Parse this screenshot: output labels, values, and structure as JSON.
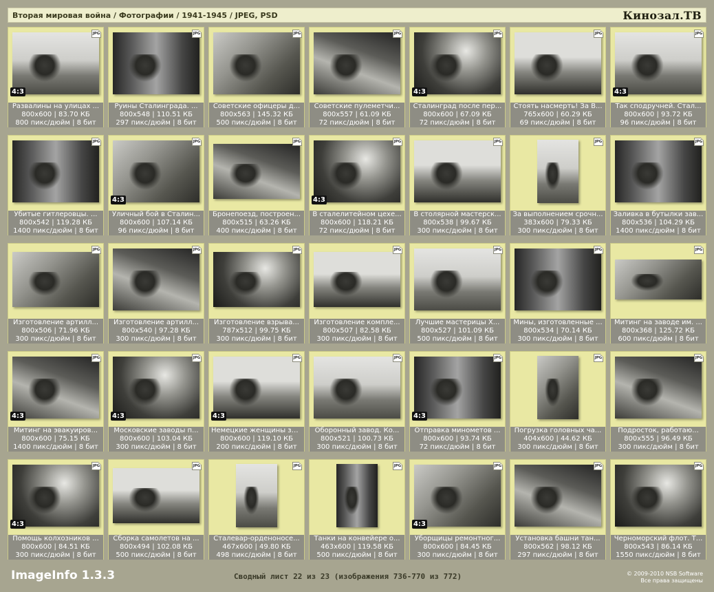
{
  "header": {
    "breadcrumb": "Вторая мировая война / Фотографии / 1941-1945 / JPEG, PSD",
    "site_logo": "Кинозал.ТВ"
  },
  "tiles": [
    {
      "name": "Развалины на улицах ...",
      "info": "800x600 | 83.70 КБ",
      "dpi": "800 пикс/дюйм | 8 бит",
      "ratio": "4:3",
      "orient": "l"
    },
    {
      "name": "Руины Сталинграда. ...",
      "info": "800x548 | 110.51 КБ",
      "dpi": "297 пикс/дюйм | 8 бит",
      "ratio": "",
      "orient": "l"
    },
    {
      "name": "Советские офицеры д...",
      "info": "800x563 | 145.32 КБ",
      "dpi": "500 пикс/дюйм | 8 бит",
      "ratio": "",
      "orient": "l"
    },
    {
      "name": "Советские пулеметчи...",
      "info": "800x557 | 61.09 КБ",
      "dpi": "72 пикс/дюйм | 8 бит",
      "ratio": "",
      "orient": "l"
    },
    {
      "name": "Сталинград после пер...",
      "info": "800x600 | 67.09 КБ",
      "dpi": "72 пикс/дюйм | 8 бит",
      "ratio": "4:3",
      "orient": "l"
    },
    {
      "name": "Стоять насмерть! За В...",
      "info": "765x600 | 60.29 КБ",
      "dpi": "69 пикс/дюйм | 8 бит",
      "ratio": "",
      "orient": "l"
    },
    {
      "name": "Так сподручней. Стал...",
      "info": "800x600 | 93.72 КБ",
      "dpi": "96 пикс/дюйм | 8 бит",
      "ratio": "4:3",
      "orient": "l"
    },
    {
      "name": "Убитые гитлеровцы. ...",
      "info": "800x542 | 119.28 КБ",
      "dpi": "1400 пикс/дюйм | 8 бит",
      "ratio": "",
      "orient": "l"
    },
    {
      "name": "Уличный бой в Сталин...",
      "info": "800x600 | 107.14 КБ",
      "dpi": "96 пикс/дюйм | 8 бит",
      "ratio": "4:3",
      "orient": "l"
    },
    {
      "name": "Бронепоезд, построен...",
      "info": "800x515 | 63.26 КБ",
      "dpi": "400 пикс/дюйм | 8 бит",
      "ratio": "",
      "orient": "w"
    },
    {
      "name": "В сталелитейном цехе...",
      "info": "800x600 | 118.21 КБ",
      "dpi": "72 пикс/дюйм | 8 бит",
      "ratio": "4:3",
      "orient": "l"
    },
    {
      "name": "В столярной мастерск...",
      "info": "800x538 | 99.67 КБ",
      "dpi": "300 пикс/дюйм | 8 бит",
      "ratio": "",
      "orient": "l"
    },
    {
      "name": "За выполнением срочн...",
      "info": "383x600 | 79.33 КБ",
      "dpi": "300 пикс/дюйм | 8 бит",
      "ratio": "",
      "orient": "p"
    },
    {
      "name": "Заливка в бутылки зав...",
      "info": "800x536 | 104.29 КБ",
      "dpi": "1400 пикс/дюйм | 8 бит",
      "ratio": "",
      "orient": "l"
    },
    {
      "name": "Изготовление артилл...",
      "info": "800x506 | 71.96 КБ",
      "dpi": "300 пикс/дюйм | 8 бит",
      "ratio": "",
      "orient": "w"
    },
    {
      "name": "Изготовление артилл...",
      "info": "800x540 | 97.28 КБ",
      "dpi": "300 пикс/дюйм | 8 бит",
      "ratio": "",
      "orient": "l"
    },
    {
      "name": "Изготовление взрыва...",
      "info": "787x512 | 99.75 КБ",
      "dpi": "300 пикс/дюйм | 8 бит",
      "ratio": "",
      "orient": "w"
    },
    {
      "name": "Изготовление компле...",
      "info": "800x507 | 82.58 КБ",
      "dpi": "300 пикс/дюйм | 8 бит",
      "ratio": "",
      "orient": "w"
    },
    {
      "name": "Лучшие мастерицы Х...",
      "info": "800x527 | 101.09 КБ",
      "dpi": "500 пикс/дюйм | 8 бит",
      "ratio": "",
      "orient": "l"
    },
    {
      "name": "Мины, изготовленные ...",
      "info": "800x534 | 70.14 КБ",
      "dpi": "300 пикс/дюйм | 8 бит",
      "ratio": "",
      "orient": "l"
    },
    {
      "name": "Митинг на заводе им. ...",
      "info": "800x368 | 125.72 КБ",
      "dpi": "600 пикс/дюйм | 8 бит",
      "ratio": "",
      "orient": "x"
    },
    {
      "name": "Митинг на эвакуиров...",
      "info": "800x600 | 75.15 КБ",
      "dpi": "1400 пикс/дюйм | 8 бит",
      "ratio": "4:3",
      "orient": "l"
    },
    {
      "name": "Московские заводы п...",
      "info": "800x600 | 103.04 КБ",
      "dpi": "300 пикс/дюйм | 8 бит",
      "ratio": "4:3",
      "orient": "l"
    },
    {
      "name": "Немецкие женщины за...",
      "info": "800x600 | 119.10 КБ",
      "dpi": "200 пикс/дюйм | 8 бит",
      "ratio": "4:3",
      "orient": "l"
    },
    {
      "name": "Оборонный завод. Ко...",
      "info": "800x521 | 100.73 КБ",
      "dpi": "300 пикс/дюйм | 8 бит",
      "ratio": "",
      "orient": "l"
    },
    {
      "name": "Отправка минометов ...",
      "info": "800x600 | 93.74 КБ",
      "dpi": "72 пикс/дюйм | 8 бит",
      "ratio": "4:3",
      "orient": "l"
    },
    {
      "name": "Погрузка головных ча...",
      "info": "404x600 | 44.62 КБ",
      "dpi": "300 пикс/дюйм | 8 бит",
      "ratio": "",
      "orient": "p"
    },
    {
      "name": "Подросток, работаю...",
      "info": "800x555 | 96.49 КБ",
      "dpi": "300 пикс/дюйм | 8 бит",
      "ratio": "",
      "orient": "l"
    },
    {
      "name": "Помощь колхозников ...",
      "info": "800x600 | 84.51 КБ",
      "dpi": "300 пикс/дюйм | 8 бит",
      "ratio": "4:3",
      "orient": "l"
    },
    {
      "name": "Сборка самолетов на ...",
      "info": "800x494 | 102.08 КБ",
      "dpi": "500 пикс/дюйм | 8 бит",
      "ratio": "",
      "orient": "w"
    },
    {
      "name": "Сталевар-орденоносе...",
      "info": "467x600 | 49.80 КБ",
      "dpi": "498 пикс/дюйм | 8 бит",
      "ratio": "",
      "orient": "p"
    },
    {
      "name": "Танки на конвейере о...",
      "info": "463x600 | 119.58 КБ",
      "dpi": "500 пикс/дюйм | 8 бит",
      "ratio": "",
      "orient": "p"
    },
    {
      "name": "Уборщицы ремонтног...",
      "info": "800x600 | 84.45 КБ",
      "dpi": "300 пикс/дюйм | 8 бит",
      "ratio": "4:3",
      "orient": "l"
    },
    {
      "name": "Установка башни тан...",
      "info": "800x562 | 98.12 КБ",
      "dpi": "297 пикс/дюйм | 8 бит",
      "ratio": "",
      "orient": "l"
    },
    {
      "name": "Черноморский флот. Т...",
      "info": "800x543 | 86.14 КБ",
      "dpi": "1550 пикс/дюйм | 8 бит",
      "ratio": "",
      "orient": "l"
    }
  ],
  "file_tag": "JPG",
  "footer": {
    "brand": "ImageInfo 1.3.3",
    "status": "Сводный лист 22 из 23 (изображения 736-770 из 772)",
    "copyright_line1": "© 2009-2010 NSB Software",
    "copyright_line2": "Все права защищены"
  }
}
